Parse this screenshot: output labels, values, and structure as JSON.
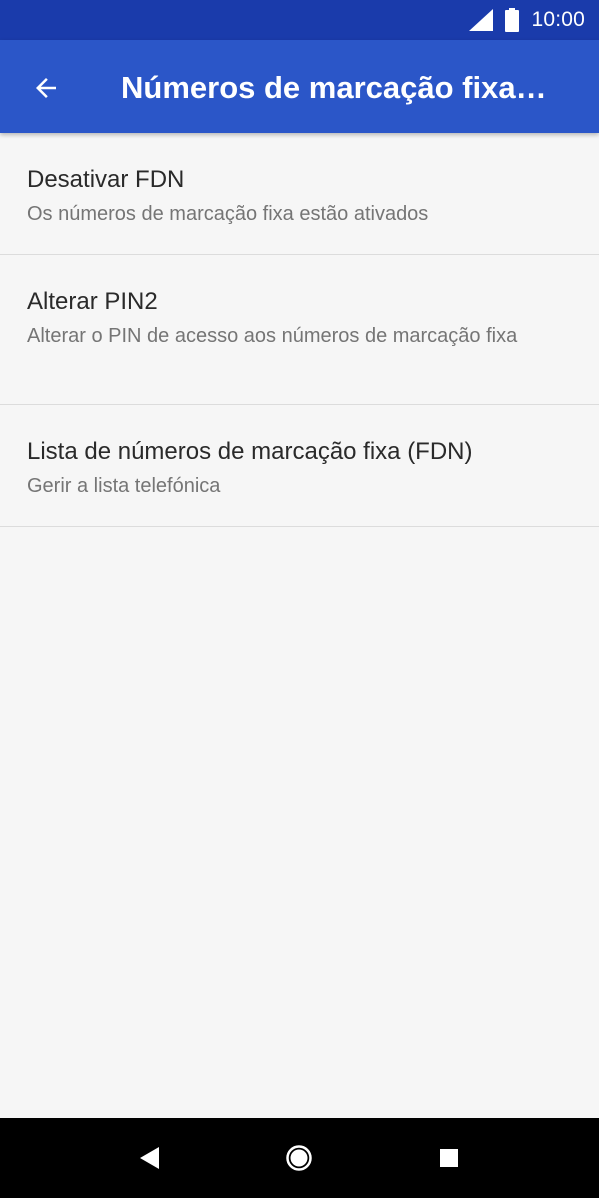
{
  "status_bar": {
    "time": "10:00",
    "icons": [
      "signal-icon",
      "battery-icon"
    ]
  },
  "app_bar": {
    "title": "Números de marcação fixa…",
    "back_icon": "arrow-left-icon"
  },
  "list": {
    "items": [
      {
        "title": "Desativar FDN",
        "subtitle": "Os números de marcação fixa estão ativados"
      },
      {
        "title": "Alterar PIN2",
        "subtitle": "Alterar o PIN de acesso aos números de marcação fixa"
      },
      {
        "title": "Lista de números de marcação fixa (FDN)",
        "subtitle": "Gerir a lista telefónica"
      }
    ]
  },
  "nav_bar": {
    "icons": [
      "back-triangle-icon",
      "home-circle-icon",
      "recents-square-icon"
    ]
  },
  "colors": {
    "status_bar": "#1a3bab",
    "app_bar": "#2b56c8",
    "background": "#f6f6f6",
    "divider": "#dcdcdc",
    "title_text": "#2a2a2a",
    "subtitle_text": "#757575",
    "nav_bar": "#000000"
  }
}
